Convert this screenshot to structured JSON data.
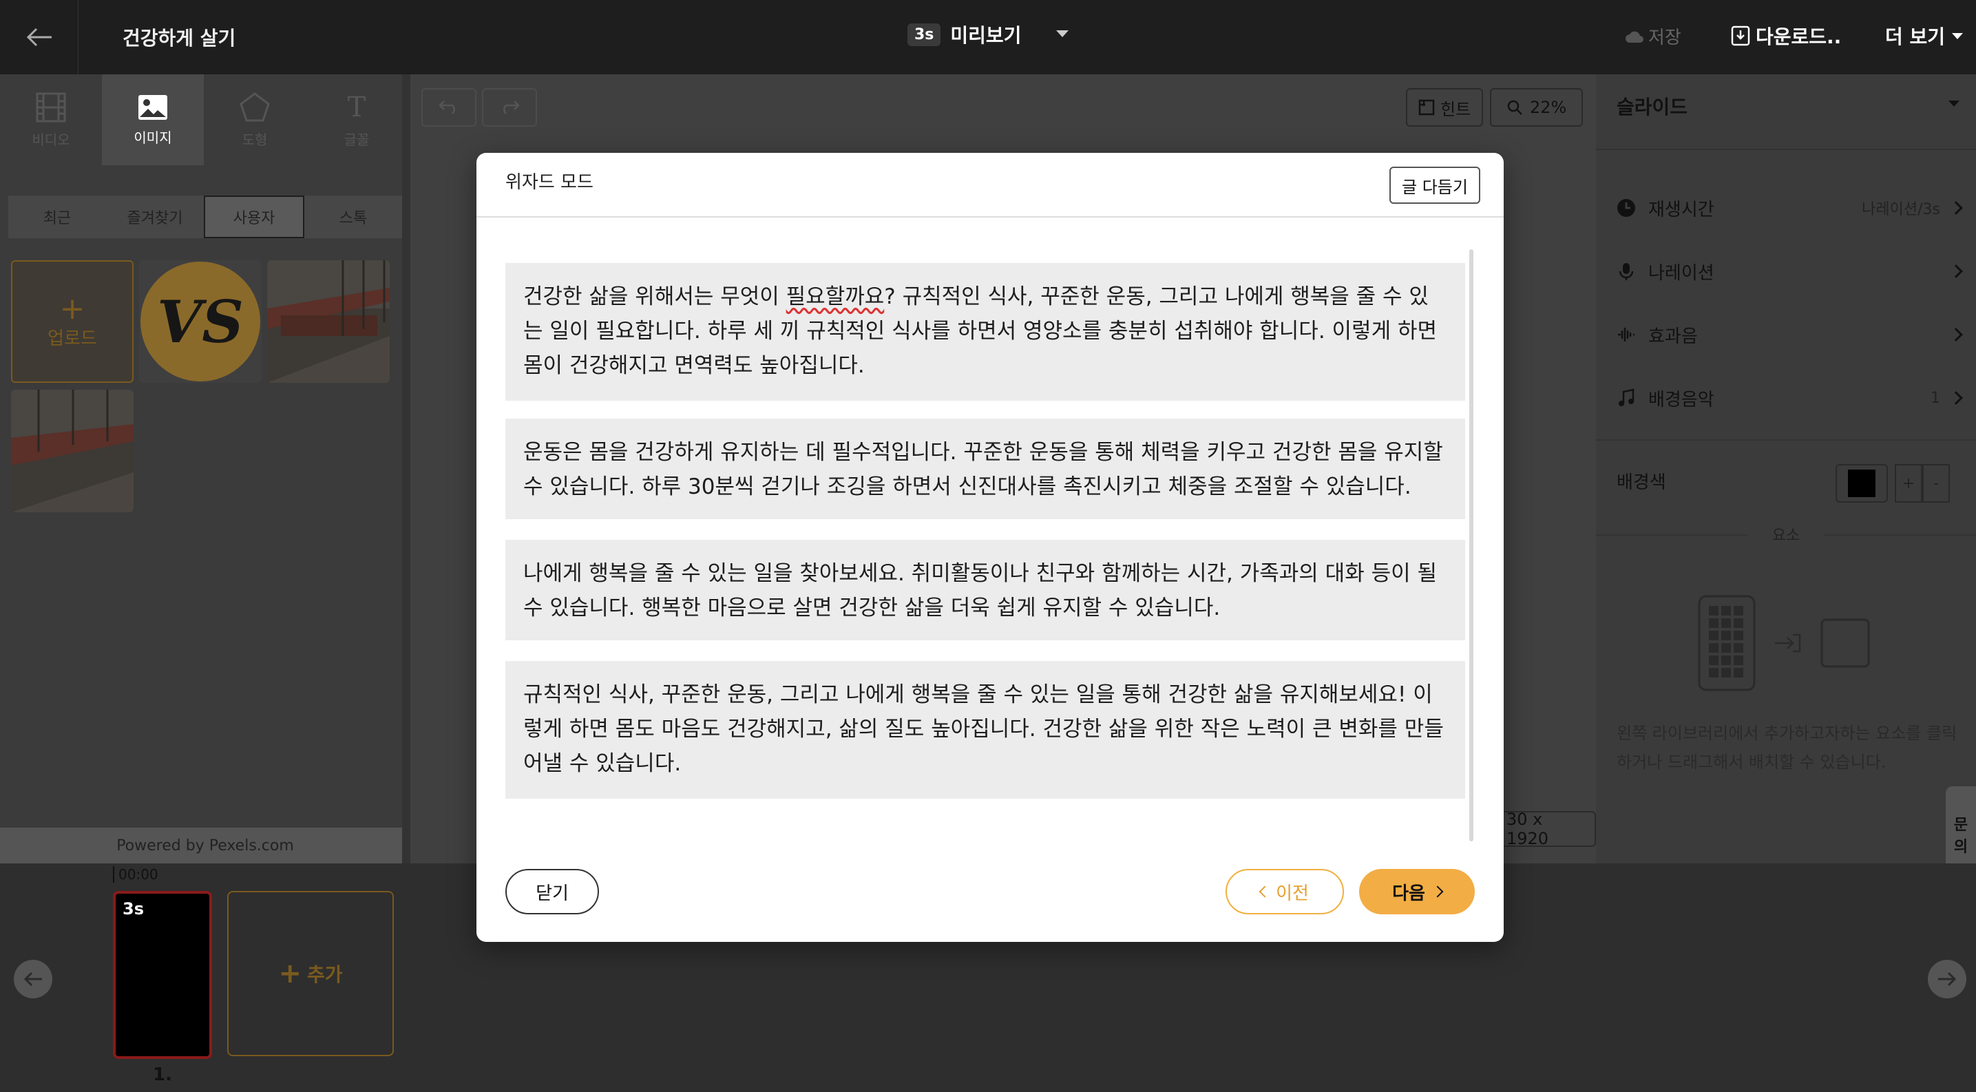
{
  "header": {
    "back_icon": "arrow-left-icon",
    "project_title": "건강하게 살기",
    "preview_duration": "3s",
    "preview_label": "미리보기",
    "save_label": "저장",
    "download_label": "다운로드..",
    "more_label": "더 보기"
  },
  "left_panel": {
    "tool_tabs": [
      {
        "label": "비디오",
        "icon": "film-icon"
      },
      {
        "label": "이미지",
        "icon": "image-icon"
      },
      {
        "label": "도형",
        "icon": "pentagon-icon"
      },
      {
        "label": "글꼴",
        "icon": "text-icon"
      }
    ],
    "library_tabs": [
      "최근",
      "즐겨찾기",
      "사용자",
      "스톡"
    ],
    "active_library_tab": "사용자",
    "upload_label": "업로드",
    "vs_text": "VS",
    "powered_by": "Powered by Pexels.com"
  },
  "canvas": {
    "hint_label": "힌트",
    "zoom_label": "22%",
    "resolution_label": "30 x 1920"
  },
  "right_panel": {
    "section_title": "슬라이드",
    "rows": [
      {
        "label": "재생시간",
        "value": "나레이션/3s",
        "icon": "clock-icon"
      },
      {
        "label": "나레이션",
        "value": "",
        "icon": "microphone-icon"
      },
      {
        "label": "효과음",
        "value": "",
        "icon": "sound-effect-icon"
      },
      {
        "label": "배경음악",
        "value": "1",
        "icon": "music-note-icon"
      }
    ],
    "bg_color_label": "배경색",
    "bg_color": "#000000",
    "plus_label": "+",
    "minus_label": "-",
    "elements_title": "요소",
    "elements_desc": "왼쪽 라이브러리에서 추가하고자하는 요소를 클릭하거나 드래그해서 배치할 수 있습니다.",
    "side_tab_label": [
      "문",
      "의"
    ]
  },
  "timeline": {
    "time_label": "00:00",
    "slide_duration": "3s",
    "slide_number": "1.",
    "add_label": "추가"
  },
  "modal": {
    "title": "위자드 모드",
    "trim_label": "글 다듬기",
    "paragraphs": [
      {
        "before": "건강한 삶을 위해서는 무엇이 ",
        "spell": "필요할까요",
        "after": "? 규칙적인 식사, 꾸준한 운동, 그리고 나에게 행복을 줄 수 있는 일이 필요합니다. 하루 세 끼 규칙적인 식사를 하면서 영양소를 충분히 섭취해야 합니다. 이렇게 하면 몸이 건강해지고 면역력도 높아집니다."
      },
      {
        "before": "운동은 몸을 건강하게 유지하는 데 필수적입니다. 꾸준한 운동을 통해 체력을 키우고 건강한 몸을 유지할 수 있습니다. 하루 30분씩 걷기나 조깅을 하면서 신진대사를 촉진시키고 체중을 조절할 수 있습니다.",
        "spell": "",
        "after": ""
      },
      {
        "before": "나에게 행복을 줄 수 있는 일을 찾아보세요. 취미활동이나 친구와 함께하는 시간, 가족과의 대화 등이 될 수 있습니다. 행복한 마음으로 살면 건강한 삶을 더욱 쉽게 유지할 수 있습니다.",
        "spell": "",
        "after": ""
      },
      {
        "before": "규칙적인 식사, 꾸준한 운동, 그리고 나에게 행복을 줄 수 있는 일을 통해 건강한 삶을 유지해보세요! 이렇게 하면 몸도 마음도 건강해지고, 삶의 질도 높아집니다. 건강한 삶을 위한 작은 노력이 큰 변화를 만들어낼 수 있습니다.",
        "spell": "",
        "after": ""
      }
    ],
    "close_label": "닫기",
    "prev_label": "이전",
    "next_label": "다음"
  },
  "colors": {
    "accent": "#f2ad45",
    "dark_bg": "#1e1e1e"
  }
}
